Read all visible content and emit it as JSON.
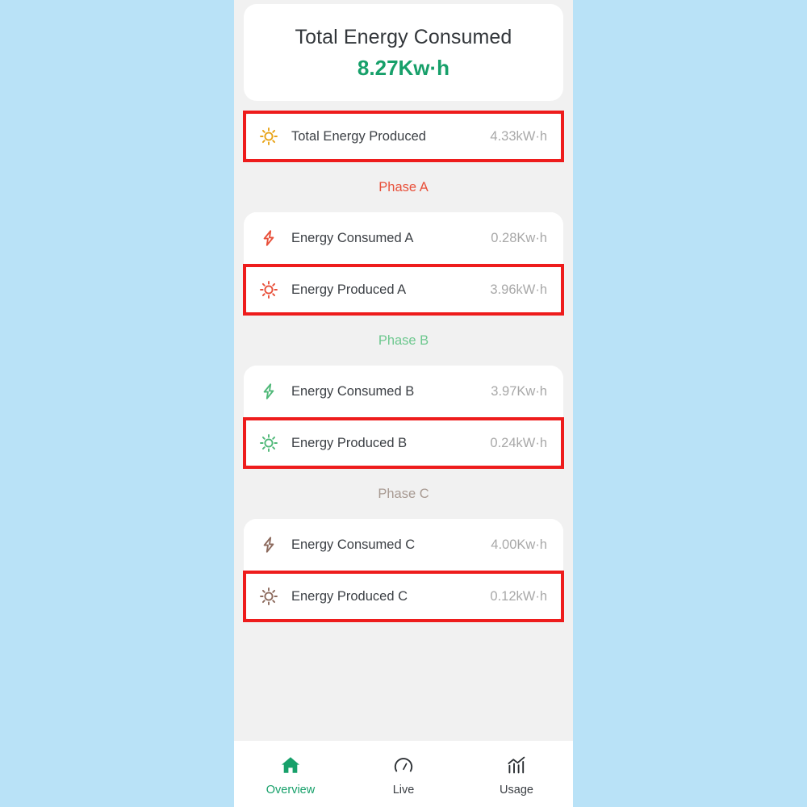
{
  "colors": {
    "page_background": "#b9e2f7",
    "screen_background": "#f1f1f1",
    "card": "#ffffff",
    "accent_green": "#17a06a",
    "annotation_red": "#ee1c1c",
    "phase_a": "#e8503a",
    "phase_b": "#4fb878",
    "phase_c": "#a08b80",
    "sun_gold": "#e8a317",
    "value_gray": "#a8a8a8",
    "label_dark": "#3b3f44"
  },
  "hero": {
    "title": "Total Energy Consumed",
    "value": "8.27Kw·h"
  },
  "total_produced": {
    "label": "Total Energy Produced",
    "value": "4.33kW·h",
    "icon": "sun-icon",
    "icon_color": "#e8a317",
    "highlighted": true
  },
  "phases": [
    {
      "heading": "Phase A",
      "color": "#e8503a",
      "rows": [
        {
          "label": "Energy Consumed A",
          "value": "0.28Kw·h",
          "icon": "lightning-bolt-icon",
          "icon_color": "#e8503a",
          "highlighted": false
        },
        {
          "label": "Energy Produced A",
          "value": "3.96kW·h",
          "icon": "sun-icon",
          "icon_color": "#e8503a",
          "highlighted": true
        }
      ]
    },
    {
      "heading": "Phase B",
      "color": "#6ec88f",
      "rows": [
        {
          "label": "Energy Consumed B",
          "value": "3.97Kw·h",
          "icon": "lightning-bolt-icon",
          "icon_color": "#4fb878",
          "highlighted": false
        },
        {
          "label": "Energy Produced B",
          "value": "0.24kW·h",
          "icon": "sun-icon",
          "icon_color": "#4fb878",
          "highlighted": true
        }
      ]
    },
    {
      "heading": "Phase C",
      "color": "#a89a92",
      "rows": [
        {
          "label": "Energy Consumed C",
          "value": "4.00Kw·h",
          "icon": "lightning-bolt-icon",
          "icon_color": "#8c6a5d",
          "highlighted": false
        },
        {
          "label": "Energy Produced C",
          "value": "0.12kW·h",
          "icon": "sun-icon",
          "icon_color": "#8c6a5d",
          "highlighted": true
        }
      ]
    }
  ],
  "navbar": {
    "items": [
      {
        "label": "Overview",
        "icon": "home-icon",
        "active": true
      },
      {
        "label": "Live",
        "icon": "gauge-icon",
        "active": false
      },
      {
        "label": "Usage",
        "icon": "bar-chart-trend-icon",
        "active": false
      }
    ]
  }
}
